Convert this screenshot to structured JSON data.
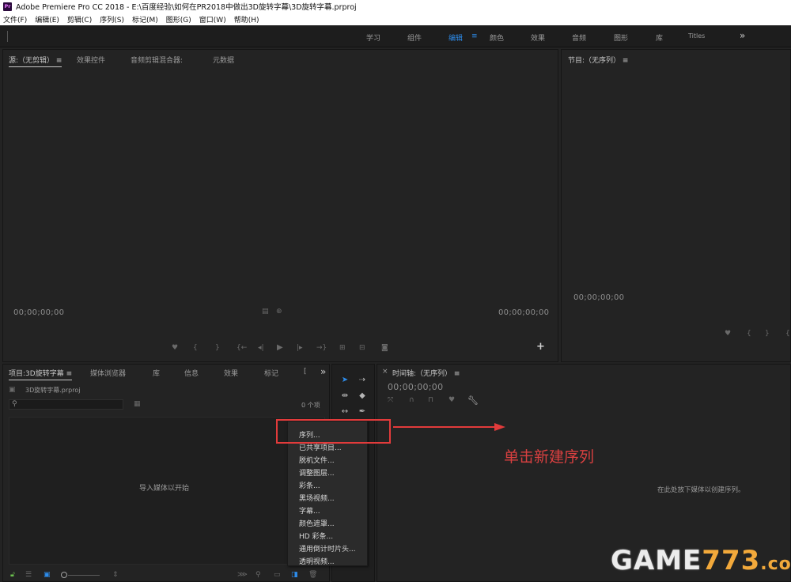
{
  "window": {
    "title": "Adobe Premiere Pro CC 2018 - E:\\百度经验\\如何在PR2018中做出3D旋转字幕\\3D旋转字幕.prproj",
    "app_icon": "Pr"
  },
  "menu": [
    "文件(F)",
    "编辑(E)",
    "剪辑(C)",
    "序列(S)",
    "标记(M)",
    "图形(G)",
    "窗口(W)",
    "帮助(H)"
  ],
  "workspaces": {
    "items": [
      "学习",
      "组件",
      "编辑",
      "颜色",
      "效果",
      "音频",
      "图形",
      "库",
      "Titles"
    ],
    "active": "编辑",
    "active_menu_glyph": "≡",
    "more_glyph": "»"
  },
  "source_panel": {
    "tabs": [
      "源:（无剪辑）",
      "效果控件",
      "音频剪辑混合器:",
      "元数据"
    ],
    "tab_menu_glyph": "≡",
    "timecode_left": "00;00;00;00",
    "timecode_right": "00;00;00;00",
    "add_glyph": "+"
  },
  "program_panel": {
    "title": "节目:（无序列）",
    "title_menu_glyph": "≡",
    "timecode": "00;00;00;00"
  },
  "project_panel": {
    "tabs": [
      "项目:3D旋转字幕",
      "媒体浏览器",
      "库",
      "信息",
      "效果",
      "标记",
      "["
    ],
    "tab_menu_glyph": "≡",
    "more_glyph": "»",
    "project_file": "3D旋转字幕.prproj",
    "item_count": "0 个项",
    "empty_hint": "导入媒体以开始"
  },
  "timeline_panel": {
    "close_glyph": "×",
    "title": "时间轴:（无序列）",
    "title_menu_glyph": "≡",
    "timecode": "00;00;00;00",
    "drop_hint": "在此处放下媒体以创建序列。"
  },
  "context_menu": [
    "序列...",
    "已共享项目...",
    "脱机文件...",
    "调整图层...",
    "彩条...",
    "黑场视频...",
    "字幕...",
    "颜色遮罩...",
    "HD 彩条...",
    "通用倒计时片头...",
    "透明视频..."
  ],
  "annotation": {
    "text": "单击新建序列",
    "color": "#e23b3b"
  },
  "watermark": {
    "text_main": "GAME",
    "text_digits": "773",
    "text_domain": ".com"
  },
  "colors": {
    "accent": "#2d8ceb",
    "panel_bg": "#232323",
    "dark_bg": "#1d1d1d"
  }
}
